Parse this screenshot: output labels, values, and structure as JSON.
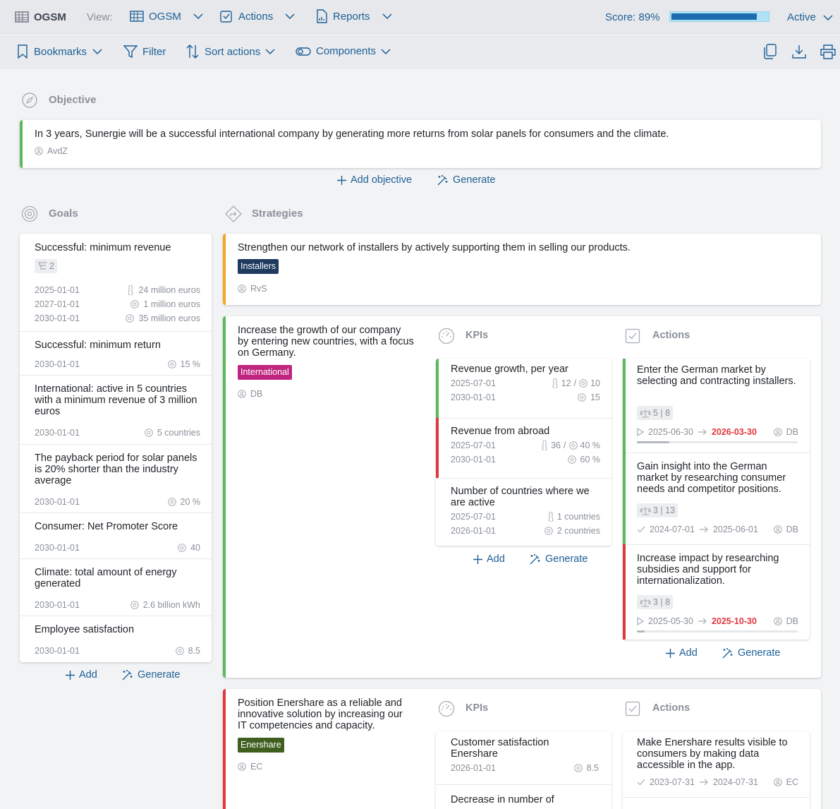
{
  "topbar": {
    "app": "OGSM",
    "view_label": "View:",
    "view_menu": "OGSM",
    "actions_menu": "Actions",
    "reports_menu": "Reports",
    "score": "Score: 89%",
    "score_fraction": 0.89,
    "status": "Active"
  },
  "toolbar": {
    "bookmarks": "Bookmarks",
    "filter": "Filter",
    "sort": "Sort actions",
    "components": "Components"
  },
  "objective": {
    "heading": "Objective",
    "text": "In 3 years, Sunergie will be a successful international company by generating more returns from solar panels for consumers and the climate.",
    "owner": "AvdZ",
    "add": "Add objective",
    "generate": "Generate"
  },
  "goals": {
    "heading": "Goals",
    "add": "Add",
    "generate": "Generate",
    "items": [
      {
        "title": "Successful: minimum revenue",
        "count": "2",
        "rows": [
          [
            "2025-01-01",
            "24 million euros"
          ],
          [
            "2027-01-01",
            "1 million euros"
          ],
          [
            "2030-01-01",
            "35 million euros"
          ]
        ]
      },
      {
        "title": "Successful: minimum return",
        "rows": [
          [
            "2030-01-01",
            "15 %"
          ]
        ]
      },
      {
        "title": "International: active in 5 countries with a minimum revenue of 3 million euros",
        "rows": [
          [
            "2030-01-01",
            "5 countries"
          ]
        ]
      },
      {
        "title": "The payback period for solar panels is 20% shorter than the industry average",
        "rows": [
          [
            "2030-01-01",
            "20 %"
          ]
        ]
      },
      {
        "title": "Consumer: Net Promoter Score",
        "rows": [
          [
            "2030-01-01",
            "40"
          ]
        ]
      },
      {
        "title": "Climate: total amount of energy generated",
        "rows": [
          [
            "2030-01-01",
            "2.6 billion kWh"
          ]
        ]
      },
      {
        "title": "Employee satisfaction",
        "rows": [
          [
            "2030-01-01",
            "8.5"
          ]
        ]
      }
    ]
  },
  "strategies": {
    "heading": "Strategies",
    "kpis_heading": "KPIs",
    "actions_heading": "Actions",
    "add": "Add",
    "generate": "Generate",
    "items": [
      {
        "title": "Strengthen our network of installers by actively supporting them in selling our products.",
        "tag": "Installers",
        "tag_color": "#1e3a5f",
        "owner": "RvS"
      },
      {
        "title": "Increase the growth of our company by entering new countries, with a focus on Germany.",
        "tag": "International",
        "tag_color": "#c0267f",
        "owner": "DB",
        "kpis": [
          {
            "title": "Revenue growth, per year",
            "d1": "2025-07-01",
            "cur": "12",
            "tgt1": "10",
            "d2": "2030-01-01",
            "tgt2": "15"
          },
          {
            "title": "Revenue from abroad",
            "d1": "2025-07-01",
            "cur": "36",
            "tgt1": "40 %",
            "d2": "2030-01-01",
            "tgt2": "60 %"
          },
          {
            "title": "Number of countries where we are active",
            "d1": "2025-07-01",
            "cur": "1 countries",
            "d2": "2026-01-01",
            "tgt2": "2 countries"
          }
        ],
        "actions": [
          {
            "title": "Enter the German market by selecting and contracting installers.",
            "tasks": "5 | 8",
            "start": "2025-06-30",
            "end": "2026-03-30",
            "owner": "DB",
            "progress": 0.2
          },
          {
            "title": "Gain insight into the German market by researching consumer needs and competitor positions.",
            "tasks": "3 | 13",
            "start": "2024-07-01",
            "end": "2025-06-01",
            "owner": "DB"
          },
          {
            "title": "Increase impact by researching subsidies and support for internationalization.",
            "tasks": "3 | 8",
            "start": "2025-05-30",
            "end": "2025-10-30",
            "owner": "DB",
            "progress": 0.05
          }
        ]
      },
      {
        "title": "Position Enershare as a reliable and innovative solution by increasing our IT competencies and capacity.",
        "tag": "Enershare",
        "tag_color": "#3f5e1f",
        "owner": "EC",
        "kpis": [
          {
            "title": "Customer satisfaction Enershare",
            "d1": "2026-01-01",
            "tgt1": "8.5"
          },
          {
            "title": "Decrease in number of"
          }
        ],
        "actions": [
          {
            "title": "Make Enershare results visible to consumers by making data accessible in the app.",
            "start": "2023-07-31",
            "end": "2024-07-31",
            "owner": "EC"
          }
        ]
      }
    ]
  },
  "colors": {
    "accent_blue": "#1d5f96",
    "ok": "#5cb85c",
    "alert": "#e0383e",
    "warn": "#f5a623"
  }
}
